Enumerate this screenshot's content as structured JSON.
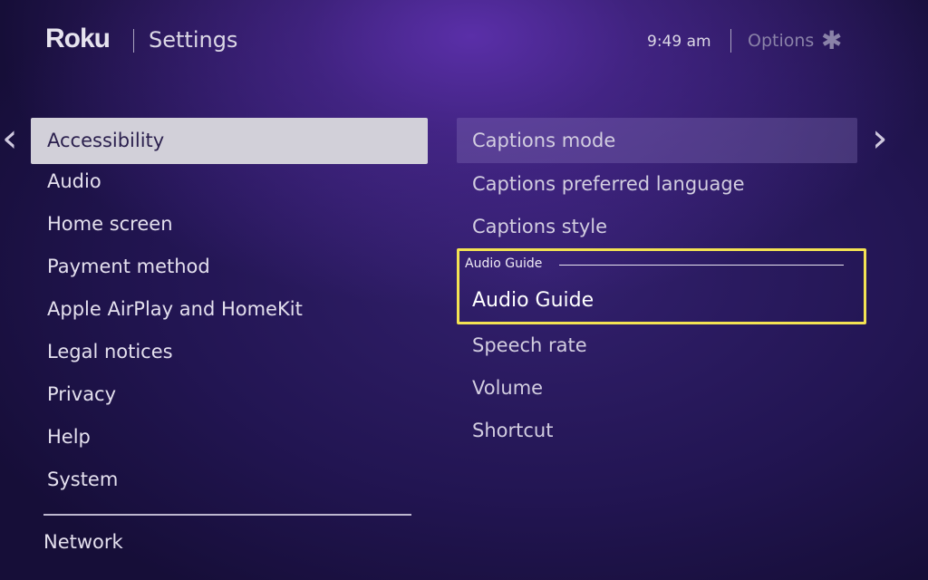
{
  "header": {
    "logo": "Roku",
    "title": "Settings",
    "time": "9:49 am",
    "options_label": "Options",
    "options_icon": "asterisk-icon"
  },
  "nav": {
    "left_arrow": "‹",
    "right_arrow": "›"
  },
  "left_menu": {
    "items": [
      {
        "label": "Accessibility",
        "selected": true
      },
      {
        "label": "Audio"
      },
      {
        "label": "Home screen"
      },
      {
        "label": "Payment method"
      },
      {
        "label": "Apple AirPlay and HomeKit"
      },
      {
        "label": "Legal notices"
      },
      {
        "label": "Privacy"
      },
      {
        "label": "Help"
      },
      {
        "label": "System"
      }
    ],
    "network": "Network"
  },
  "right_menu": {
    "items": [
      {
        "label": "Captions mode",
        "focused": true
      },
      {
        "label": "Captions preferred language"
      },
      {
        "label": "Captions style"
      }
    ],
    "audio_guide_section": {
      "header": "Audio Guide",
      "item": "Audio Guide"
    },
    "lower_items": [
      {
        "label": "Speech rate"
      },
      {
        "label": "Volume"
      },
      {
        "label": "Shortcut"
      }
    ]
  },
  "colors": {
    "highlight_border": "#f3e253",
    "selected_bg": "#d2d0d9",
    "background": "#221552"
  }
}
